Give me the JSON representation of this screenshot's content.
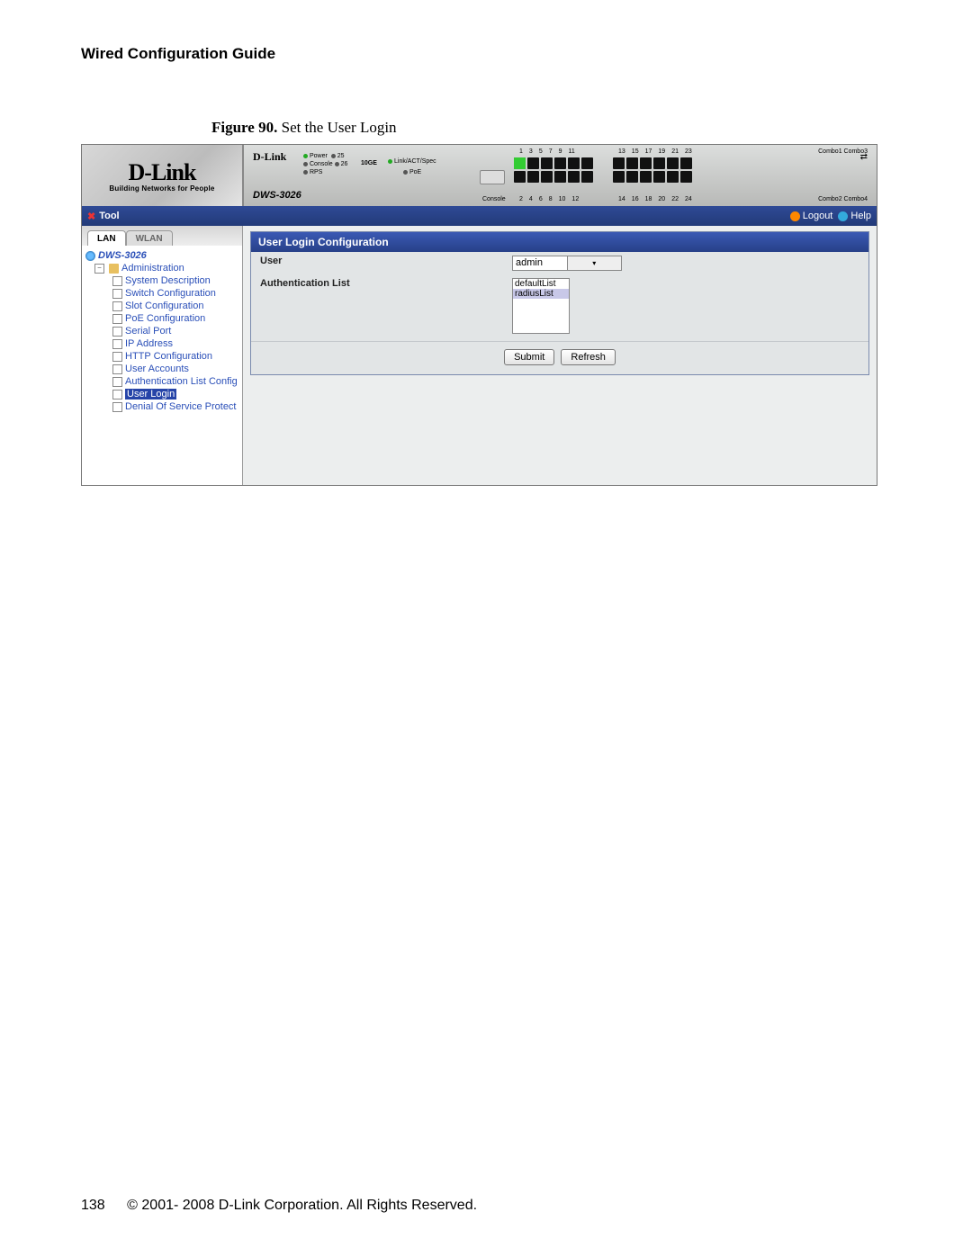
{
  "doc": {
    "title": "Wired Configuration Guide",
    "page_number": "138",
    "copyright": "© 2001- 2008 D-Link Corporation. All Rights Reserved."
  },
  "figure": {
    "number": "Figure 90.",
    "title": "Set the User Login"
  },
  "logo": {
    "brand": "D-Link",
    "tagline": "Building Networks for People"
  },
  "device": {
    "brand": "D-Link",
    "model": "DWS-3026",
    "led_power": "Power",
    "led_console": "Console",
    "led_rps": "RPS",
    "p25": "25",
    "p26": "26",
    "tenGE": "10GE",
    "link": "Link/ACT/Spec",
    "poe": "PoE",
    "console_lbl": "Console",
    "top_odd": [
      "1",
      "3",
      "5",
      "7",
      "9",
      "11"
    ],
    "top_odd2": [
      "13",
      "15",
      "17",
      "19",
      "21",
      "23"
    ],
    "bot_even": [
      "2",
      "4",
      "6",
      "8",
      "10",
      "12"
    ],
    "bot_even2": [
      "14",
      "16",
      "18",
      "20",
      "22",
      "24"
    ],
    "combo1": "Combo1 Combo3",
    "combo2": "Combo2 Combo4"
  },
  "toolbar": {
    "tool": "Tool",
    "logout": "Logout",
    "help": "Help"
  },
  "sidebar": {
    "tabs": {
      "lan": "LAN",
      "wlan": "WLAN"
    },
    "root": "DWS-3026",
    "admin": "Administration",
    "items": [
      "System Description",
      "Switch Configuration",
      "Slot Configuration",
      "PoE Configuration",
      "Serial Port",
      "IP Address",
      "HTTP Configuration",
      "User Accounts",
      "Authentication List Config",
      "User Login",
      "Denial Of Service Protect"
    ]
  },
  "panel": {
    "title": "User Login Configuration",
    "user_label": "User",
    "user_value": "admin",
    "authlist_label": "Authentication List",
    "authlist_options": [
      "defaultList",
      "radiusList"
    ],
    "authlist_selected": "radiusList",
    "submit": "Submit",
    "refresh": "Refresh"
  }
}
